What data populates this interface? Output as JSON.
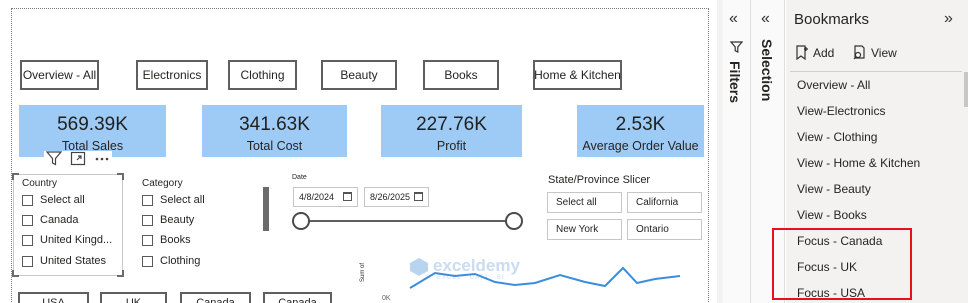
{
  "nav_buttons": [
    {
      "label": "Overview - All"
    },
    {
      "label": "Electronics"
    },
    {
      "label": "Clothing"
    },
    {
      "label": "Beauty"
    },
    {
      "label": "Books"
    },
    {
      "label": "Home & Kitchen"
    }
  ],
  "kpis": [
    {
      "value": "569.39K",
      "label": "Total Sales"
    },
    {
      "value": "341.63K",
      "label": "Total Cost"
    },
    {
      "value": "227.76K",
      "label": "Profit"
    },
    {
      "value": "2.53K",
      "label": "Average Order Value"
    }
  ],
  "country_slicer": {
    "title": "Country",
    "items": [
      "Select all",
      "Canada",
      "United Kingd...",
      "United States"
    ]
  },
  "category_slicer": {
    "title": "Category",
    "items": [
      "Select all",
      "Beauty",
      "Books",
      "Clothing"
    ]
  },
  "date_slicer": {
    "title": "Date",
    "start": "4/8/2024",
    "end": "8/26/2025"
  },
  "state_slicer": {
    "title": "State/Province Slicer",
    "items": [
      "Select all",
      "California",
      "New York",
      "Ontario"
    ]
  },
  "line_chart": {
    "y_axis_title": "Sum of",
    "y_tick": "0K"
  },
  "watermark": {
    "brand": "exceldemy",
    "tagline": "EXCEL · DATA · BI"
  },
  "bottom_buttons": [
    "USA",
    "UK",
    "Canada",
    "Canada"
  ],
  "panes": {
    "filters": "Filters",
    "selection": "Selection"
  },
  "bookmarks": {
    "title": "Bookmarks",
    "add_label": "Add",
    "view_label": "View",
    "items": [
      "Overview - All",
      "View-Electronics",
      "View - Clothing",
      "View - Home & Kitchen",
      "View - Beauty",
      "View - Books",
      "Focus - Canada",
      "Focus - UK",
      "Focus - USA"
    ]
  },
  "colors": {
    "kpi_fill": "#9dcbf6",
    "highlight": "#e8101f",
    "line_series": "#3a8de0",
    "pane_bg": "#f3f2f1"
  }
}
